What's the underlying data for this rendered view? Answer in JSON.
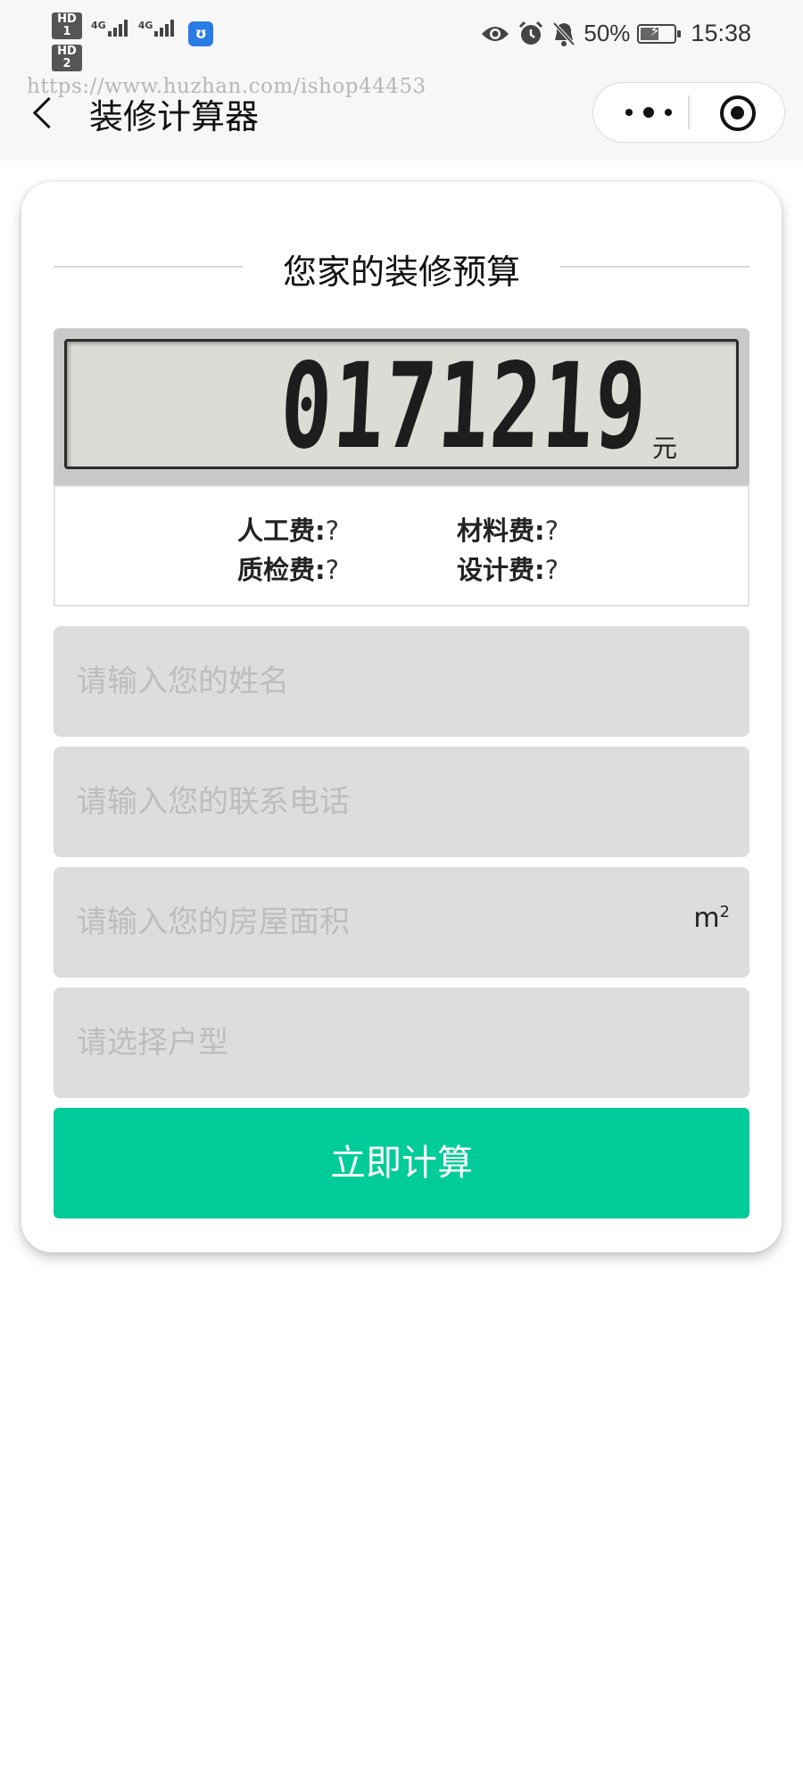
{
  "status_bar": {
    "hd1": "HD 1",
    "hd2": "HD 2",
    "sim1": "4G",
    "sim2": "4G",
    "battery": "50%",
    "time": "15:38",
    "icons": [
      "eye-icon",
      "alarm-icon",
      "bell-muted-icon",
      "battery-charging-icon"
    ]
  },
  "watermark": "https://www.huzhan.com/ishop44453",
  "nav": {
    "title": "装修计算器"
  },
  "card": {
    "heading": "您家的装修预算",
    "display": {
      "value": "0171219",
      "unit": "元"
    },
    "costs": [
      {
        "label": "人工费:",
        "value": "?"
      },
      {
        "label": "材料费:",
        "value": "?"
      },
      {
        "label": "质检费:",
        "value": "?"
      },
      {
        "label": "设计费:",
        "value": "?"
      }
    ],
    "fields": {
      "name_placeholder": "请输入您的姓名",
      "phone_placeholder": "请输入您的联系电话",
      "area_placeholder": "请输入您的房屋面积",
      "area_unit": "m",
      "area_unit_sup": "2",
      "type_placeholder": "请选择户型"
    },
    "submit_label": "立即计算"
  },
  "colors": {
    "accent": "#00cc99",
    "field_bg": "#dddddd",
    "lcd_bg": "#dcdcd7"
  }
}
